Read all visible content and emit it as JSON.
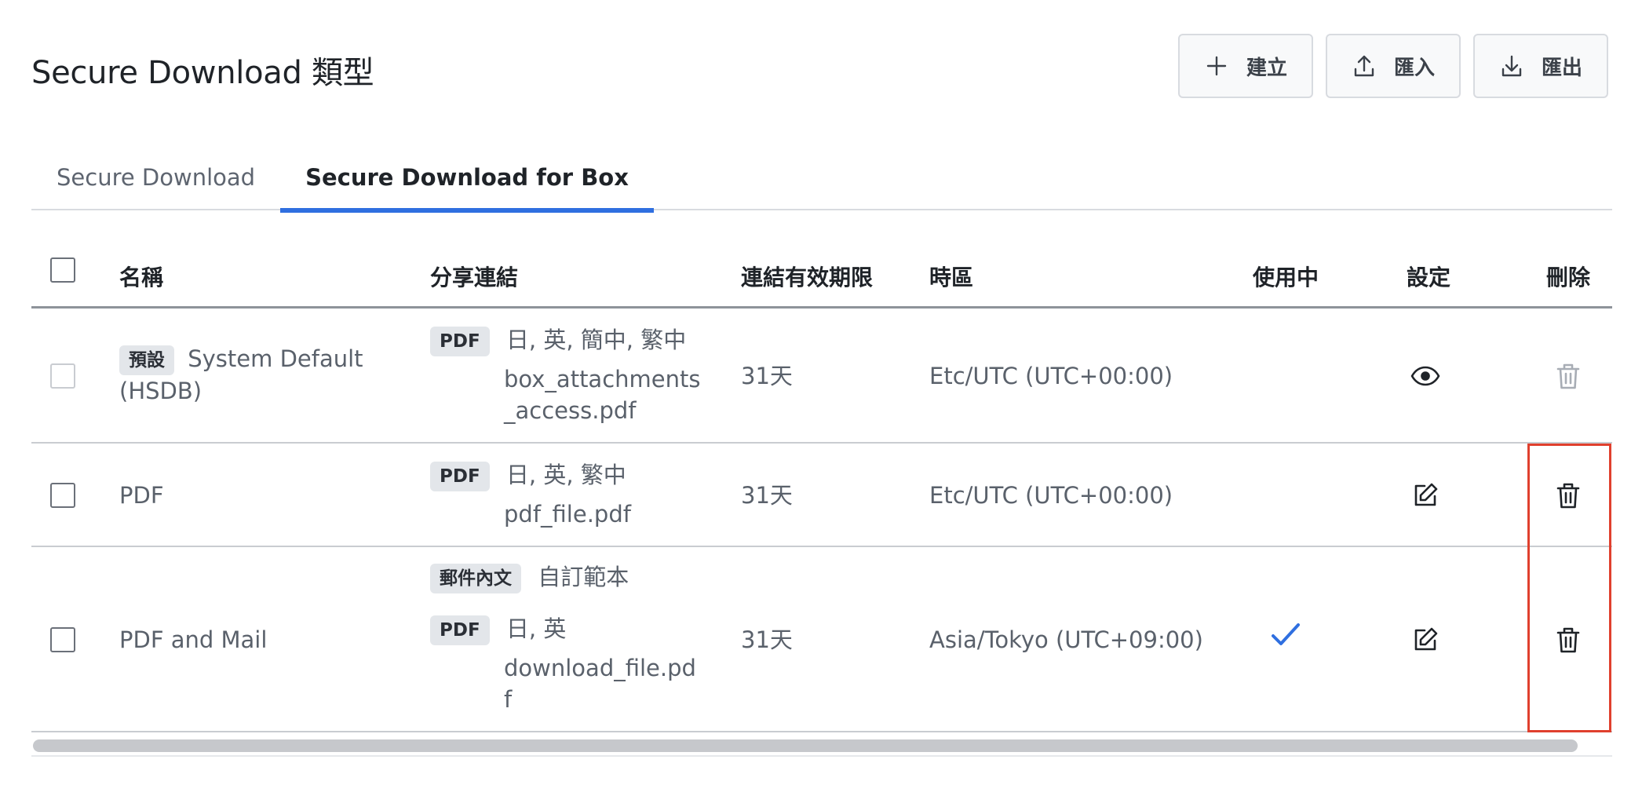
{
  "header": {
    "title": "Secure Download 類型",
    "buttons": {
      "create": "建立",
      "import": "匯入",
      "export": "匯出"
    }
  },
  "tabs": [
    {
      "label": "Secure Download",
      "active": false
    },
    {
      "label": "Secure Download for Box",
      "active": true
    }
  ],
  "table": {
    "columns": {
      "name": "名稱",
      "share_link": "分享連結",
      "link_expiry": "連結有效期限",
      "timezone": "時區",
      "in_use": "使用中",
      "settings": "設定",
      "delete": "刪除"
    },
    "rows": [
      {
        "default_badge": "預設",
        "name_line1": "System Default",
        "name_line2": "(HSDB)",
        "pdf_badge": "PDF",
        "languages": "日, 英, 簡中, 繁中",
        "file_line1": "box_attachments",
        "file_line2": "_access.pdf",
        "expiry": "31天",
        "timezone": "Etc/UTC (UTC+00:00)",
        "in_use": false,
        "settings_icon": "eye-icon",
        "delete_enabled": false
      },
      {
        "name": "PDF",
        "pdf_badge": "PDF",
        "languages": "日, 英, 繁中",
        "file": "pdf_file.pdf",
        "expiry": "31天",
        "timezone": "Etc/UTC (UTC+00:00)",
        "in_use": false,
        "settings_icon": "edit-icon",
        "delete_enabled": true
      },
      {
        "name": "PDF and Mail",
        "mail_badge": "郵件內文",
        "mail_template": "自訂範本",
        "pdf_badge": "PDF",
        "languages": "日, 英",
        "file_line1": "download_file.pd",
        "file_line2": "f",
        "expiry": "31天",
        "timezone": "Asia/Tokyo (UTC+09:00)",
        "in_use": true,
        "settings_icon": "edit-icon",
        "delete_enabled": true
      }
    ]
  },
  "colors": {
    "accent": "#2f6fe0",
    "highlight": "#e0402e"
  }
}
